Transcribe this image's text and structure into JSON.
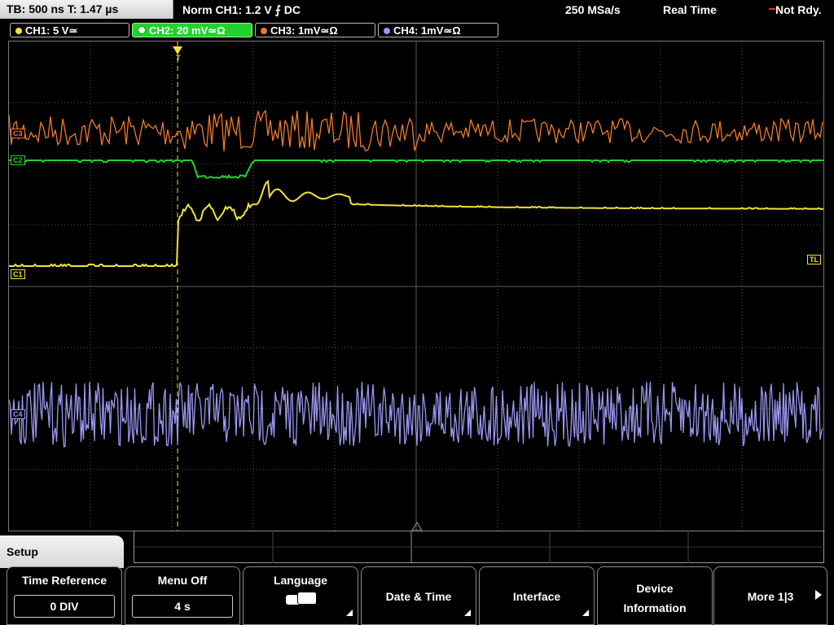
{
  "top": {
    "timebase": "TB: 500 ns   T: 1.47 µs",
    "trigger": "Norm     CH1: 1.2 V ⨍ DC",
    "sample_rate": "250 MSa/s",
    "mode": "Real Time",
    "status": "Not Rdy."
  },
  "channels": [
    {
      "label": "CH1: 5 V≃",
      "color": "#f2e33a"
    },
    {
      "label": "CH2: 20 mV≃Ω",
      "color": "#22d32a"
    },
    {
      "label": "CH3: 1mV≃Ω",
      "color": "#f07a2a"
    },
    {
      "label": "CH4: 1mV≃Ω",
      "color": "#9a96f0"
    }
  ],
  "markers": {
    "c3": "C3",
    "c2": "C2",
    "c1": "C1",
    "c4": "C4",
    "tl": "TL",
    "t": "T"
  },
  "menu": {
    "title": "Setup",
    "softkeys": [
      {
        "label": "Time Reference",
        "value": "0 DIV"
      },
      {
        "label": "Menu Off",
        "value": "4 s"
      },
      {
        "label": "Language",
        "icon": "speech-bubble-icon"
      },
      {
        "label": "Date & Time"
      },
      {
        "label": "Interface"
      },
      {
        "label": "Device Information"
      },
      {
        "label": "More 1|3"
      }
    ]
  },
  "colors": {
    "ch1": "#f2e33a",
    "ch2": "#22d32a",
    "ch3": "#f07a2a",
    "ch4": "#9a96f0",
    "grid": "#5a5a5a"
  }
}
